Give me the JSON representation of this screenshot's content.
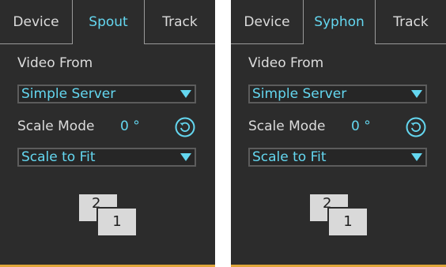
{
  "panels": [
    {
      "tabs": [
        "Device",
        "Spout",
        "Track"
      ],
      "active_tab": "Spout",
      "video_from_label": "Video From",
      "video_from_value": "Simple Server",
      "scale_mode_label": "Scale Mode",
      "rotation_value": "0 °",
      "scale_value": "Scale to Fit",
      "screen_back_label": "2",
      "screen_front_label": "1"
    },
    {
      "tabs": [
        "Device",
        "Syphon",
        "Track"
      ],
      "active_tab": "Syphon",
      "video_from_label": "Video From",
      "video_from_value": "Simple Server",
      "scale_mode_label": "Scale Mode",
      "rotation_value": "0 °",
      "scale_value": "Scale to Fit",
      "screen_back_label": "2",
      "screen_front_label": "1"
    }
  ],
  "colors": {
    "panel_bg": "#2c2c2c",
    "accent": "#64d7f0",
    "text": "#dcdcdc",
    "bottom_bar": "#e0a63a"
  },
  "icons": {
    "reset": "reset-rotation-icon",
    "dropdown": "chevron-down-icon",
    "screens": "screen-select-icon"
  }
}
